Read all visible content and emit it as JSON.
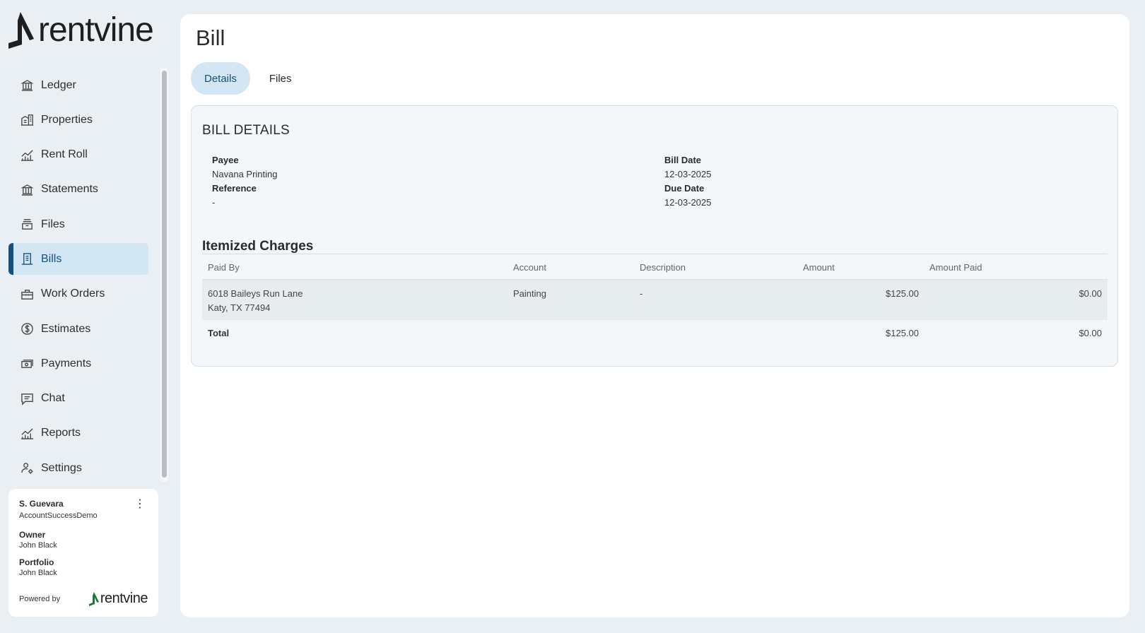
{
  "brand": {
    "name": "rentvine"
  },
  "sidebar": {
    "items": [
      {
        "label": "Ledger",
        "icon": "bank-icon",
        "active": false
      },
      {
        "label": "Properties",
        "icon": "buildings-icon",
        "active": false
      },
      {
        "label": "Rent Roll",
        "icon": "chart-icon",
        "active": false
      },
      {
        "label": "Statements",
        "icon": "bank-icon",
        "active": false
      },
      {
        "label": "Files",
        "icon": "archive-icon",
        "active": false
      },
      {
        "label": "Bills",
        "icon": "receipt-icon",
        "active": true
      },
      {
        "label": "Work Orders",
        "icon": "toolbox-icon",
        "active": false
      },
      {
        "label": "Estimates",
        "icon": "dollar-icon",
        "active": false
      },
      {
        "label": "Payments",
        "icon": "cash-icon",
        "active": false
      },
      {
        "label": "Chat",
        "icon": "message-icon",
        "active": false
      },
      {
        "label": "Reports",
        "icon": "chart-icon",
        "active": false
      },
      {
        "label": "Settings",
        "icon": "user-gear-icon",
        "active": false
      }
    ]
  },
  "user": {
    "name": "S. Guevara",
    "account": "AccountSuccessDemo",
    "owner_label": "Owner",
    "owner": "John Black",
    "portfolio_label": "Portfolio",
    "portfolio": "John Black",
    "powered_by": "Powered by",
    "powered_brand": "rentvine"
  },
  "page": {
    "title": "Bill",
    "tabs": [
      {
        "label": "Details",
        "active": true
      },
      {
        "label": "Files",
        "active": false
      }
    ]
  },
  "bill": {
    "section_title": "BILL DETAILS",
    "payee_label": "Payee",
    "payee": "Navana Printing",
    "reference_label": "Reference",
    "reference": "-",
    "bill_date_label": "Bill Date",
    "bill_date": "12-03-2025",
    "due_date_label": "Due Date",
    "due_date": "12-03-2025"
  },
  "charges": {
    "title": "Itemized Charges",
    "columns": [
      "Paid By",
      "Account",
      "Description",
      "Amount",
      "Amount Paid"
    ],
    "rows": [
      {
        "paid_by_line1": "6018 Baileys Run Lane",
        "paid_by_line2": "Katy, TX 77494",
        "account": "Painting",
        "description": "-",
        "amount": "$125.00",
        "amount_paid": "$0.00"
      }
    ],
    "total_label": "Total",
    "total_amount": "$125.00",
    "total_paid": "$0.00"
  },
  "colors": {
    "accent": "#16507a",
    "active_bg": "#d3e6f3",
    "page_bg": "#e9eff3",
    "brand_green": "#1a7a3a"
  }
}
